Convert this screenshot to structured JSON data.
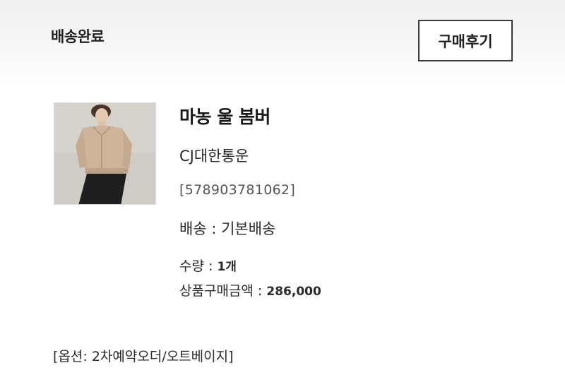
{
  "order": {
    "status": "배송완료",
    "review_button": "구매후기"
  },
  "product": {
    "name": "마농 울 봄버",
    "image_icon": "product-thumbnail",
    "carrier": "CJ대한통운",
    "tracking": "[578903781062]",
    "shipping_label": "배송 : ",
    "shipping_value": "기본배송",
    "quantity_label": "수량 : ",
    "quantity_value": "1개",
    "price_label": "상품구매금액 : ",
    "price_value": "286,000",
    "option": "[옵션: 2차예약오더/오트베이지]"
  },
  "colors": {
    "background": "#ffffff",
    "button_border": "#3a3a3a",
    "text": "#1f1f1f",
    "muted": "#555555"
  }
}
